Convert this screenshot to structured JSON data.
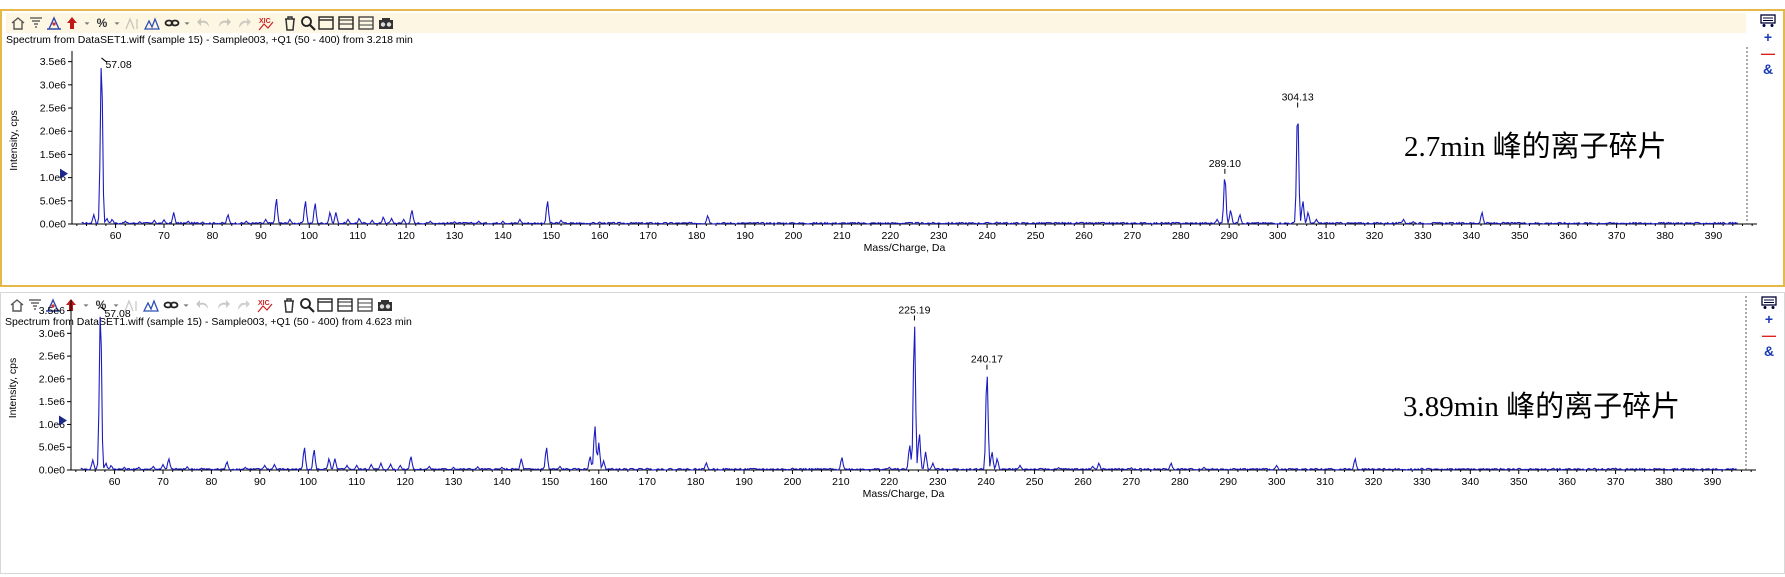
{
  "panes": [
    {
      "id": "pane1",
      "title": "Spectrum from DataSET1.wiff (sample 15) - Sample003, +Q1 (50 - 400) from 3.218 min",
      "annotation": "2.7min 峰的离子碎片",
      "ylabel": "Intensity, cps",
      "xlabel": "Mass/Charge, Da"
    },
    {
      "id": "pane2",
      "title": "Spectrum from DataSET1.wiff (sample 15) - Sample003, +Q1 (50 - 400) from 4.623 min",
      "annotation": "3.89min 峰的离子碎片",
      "ylabel": "Intensity, cps",
      "xlabel": "Mass/Charge, Da"
    }
  ],
  "toolbar": {
    "percent_label": "%",
    "icons": [
      "home-icon",
      "filter-icon",
      "peak-icon",
      "arrow-up-icon",
      "dropdown-icon",
      "percent-icon",
      "dropdown-icon",
      "label-icon",
      "triangle-icon",
      "link-icon",
      "dropdown-icon",
      "back-icon",
      "forward-icon",
      "redo-icon",
      "xic-icon",
      "trash-icon",
      "zoom-icon",
      "window1-icon",
      "window2-icon",
      "window3-icon",
      "camera-icon"
    ]
  },
  "side_tools": {
    "plus": "+",
    "minus": "—",
    "amp": "&"
  },
  "chart_data": [
    {
      "type": "line",
      "title": "Spectrum from DataSET1.wiff (sample 15) - Sample003, +Q1 (50 - 400) from 3.218 min",
      "xlabel": "Mass/Charge, Da",
      "ylabel": "Intensity, cps",
      "xlim": [
        51,
        399
      ],
      "ylim": [
        0,
        3600000
      ],
      "x_ticks": [
        60,
        70,
        80,
        90,
        100,
        110,
        120,
        130,
        140,
        150,
        160,
        170,
        180,
        190,
        200,
        210,
        220,
        230,
        240,
        250,
        260,
        270,
        280,
        290,
        300,
        310,
        320,
        330,
        340,
        350,
        360,
        370,
        380,
        390
      ],
      "y_ticks": [
        "0.0e0",
        "5.0e5",
        "1.0e6",
        "1.5e6",
        "2.0e6",
        "2.5e6",
        "3.0e6",
        "3.5e6"
      ],
      "y_tick_values": [
        0,
        500000,
        1000000,
        1500000,
        2000000,
        2500000,
        3000000,
        3500000
      ],
      "peaks": [
        [
          55.5,
          200000
        ],
        [
          57.08,
          3580000
        ],
        [
          58.2,
          120000
        ],
        [
          59.3,
          100000
        ],
        [
          62,
          60000
        ],
        [
          65,
          50000
        ],
        [
          68,
          80000
        ],
        [
          70,
          90000
        ],
        [
          72,
          250000
        ],
        [
          75,
          60000
        ],
        [
          78,
          40000
        ],
        [
          83.2,
          200000
        ],
        [
          87,
          60000
        ],
        [
          91,
          100000
        ],
        [
          93.2,
          550000
        ],
        [
          96,
          100000
        ],
        [
          99.2,
          500000
        ],
        [
          101.2,
          450000
        ],
        [
          104.3,
          250000
        ],
        [
          105.5,
          250000
        ],
        [
          108,
          100000
        ],
        [
          110.3,
          120000
        ],
        [
          113,
          80000
        ],
        [
          115.3,
          150000
        ],
        [
          117,
          120000
        ],
        [
          119.5,
          100000
        ],
        [
          121.2,
          300000
        ],
        [
          125,
          60000
        ],
        [
          130,
          50000
        ],
        [
          135,
          60000
        ],
        [
          140,
          60000
        ],
        [
          143.5,
          100000
        ],
        [
          149.2,
          500000
        ],
        [
          152,
          80000
        ],
        [
          160,
          40000
        ],
        [
          182.3,
          180000
        ],
        [
          200,
          20000
        ],
        [
          242,
          40000
        ],
        [
          287.5,
          100000
        ],
        [
          289.1,
          1060000
        ],
        [
          290.3,
          300000
        ],
        [
          292.2,
          200000
        ],
        [
          304.13,
          2490000
        ],
        [
          305.2,
          500000
        ],
        [
          306.3,
          250000
        ],
        [
          308,
          100000
        ],
        [
          326,
          100000
        ],
        [
          328,
          50000
        ],
        [
          342.2,
          250000
        ],
        [
          350,
          30000
        ]
      ],
      "labels": [
        {
          "x": 57.08,
          "text": "57.08"
        },
        {
          "x": 289.1,
          "text": "289.10"
        },
        {
          "x": 304.13,
          "text": "304.13"
        }
      ]
    },
    {
      "type": "line",
      "title": "Spectrum from DataSET1.wiff (sample 15) - Sample003, +Q1 (50 - 400) from 4.623 min",
      "xlabel": "Mass/Charge, Da",
      "ylabel": "Intensity, cps",
      "xlim": [
        51,
        399
      ],
      "ylim": [
        0,
        3600000
      ],
      "x_ticks": [
        60,
        70,
        80,
        90,
        100,
        110,
        120,
        130,
        140,
        150,
        160,
        170,
        180,
        190,
        200,
        210,
        220,
        230,
        240,
        250,
        260,
        270,
        280,
        290,
        300,
        310,
        320,
        330,
        340,
        350,
        360,
        370,
        380,
        390
      ],
      "y_ticks": [
        "0.0e0",
        "5.0e5",
        "1.0e6",
        "1.5e6",
        "2.0e6",
        "2.5e6",
        "3.0e6",
        "3.5e6"
      ],
      "y_tick_values": [
        0,
        500000,
        1000000,
        1500000,
        2000000,
        2500000,
        3000000,
        3500000
      ],
      "peaks": [
        [
          55.5,
          220000
        ],
        [
          57.08,
          3580000
        ],
        [
          58.2,
          150000
        ],
        [
          59.3,
          100000
        ],
        [
          62,
          60000
        ],
        [
          65,
          60000
        ],
        [
          68,
          80000
        ],
        [
          70,
          120000
        ],
        [
          71.2,
          250000
        ],
        [
          75,
          70000
        ],
        [
          78,
          40000
        ],
        [
          83.2,
          180000
        ],
        [
          87,
          60000
        ],
        [
          91,
          100000
        ],
        [
          93,
          120000
        ],
        [
          99.2,
          500000
        ],
        [
          101.2,
          450000
        ],
        [
          104.3,
          250000
        ],
        [
          105.5,
          250000
        ],
        [
          108,
          100000
        ],
        [
          110,
          100000
        ],
        [
          113,
          120000
        ],
        [
          115,
          150000
        ],
        [
          117,
          130000
        ],
        [
          119,
          100000
        ],
        [
          121.2,
          300000
        ],
        [
          125,
          80000
        ],
        [
          130,
          60000
        ],
        [
          135,
          70000
        ],
        [
          140,
          60000
        ],
        [
          144,
          250000
        ],
        [
          149.2,
          500000
        ],
        [
          152,
          80000
        ],
        [
          158.2,
          300000
        ],
        [
          159.2,
          980000
        ],
        [
          160,
          600000
        ],
        [
          161,
          200000
        ],
        [
          170,
          40000
        ],
        [
          182.2,
          160000
        ],
        [
          200,
          40000
        ],
        [
          210.2,
          280000
        ],
        [
          220,
          60000
        ],
        [
          224.2,
          550000
        ],
        [
          225.19,
          3260000
        ],
        [
          226.2,
          800000
        ],
        [
          227.5,
          400000
        ],
        [
          229,
          150000
        ],
        [
          240.17,
          2180000
        ],
        [
          241.2,
          400000
        ],
        [
          242.3,
          250000
        ],
        [
          247,
          100000
        ],
        [
          255,
          50000
        ],
        [
          262,
          80000
        ],
        [
          263.3,
          150000
        ],
        [
          270,
          50000
        ],
        [
          278.2,
          150000
        ],
        [
          285,
          60000
        ],
        [
          300,
          100000
        ],
        [
          316.2,
          250000
        ],
        [
          330,
          40000
        ],
        [
          370,
          40000
        ]
      ],
      "labels": [
        {
          "x": 57.08,
          "text": "57.08"
        },
        {
          "x": 225.19,
          "text": "225.19"
        },
        {
          "x": 240.17,
          "text": "240.17"
        }
      ]
    }
  ]
}
